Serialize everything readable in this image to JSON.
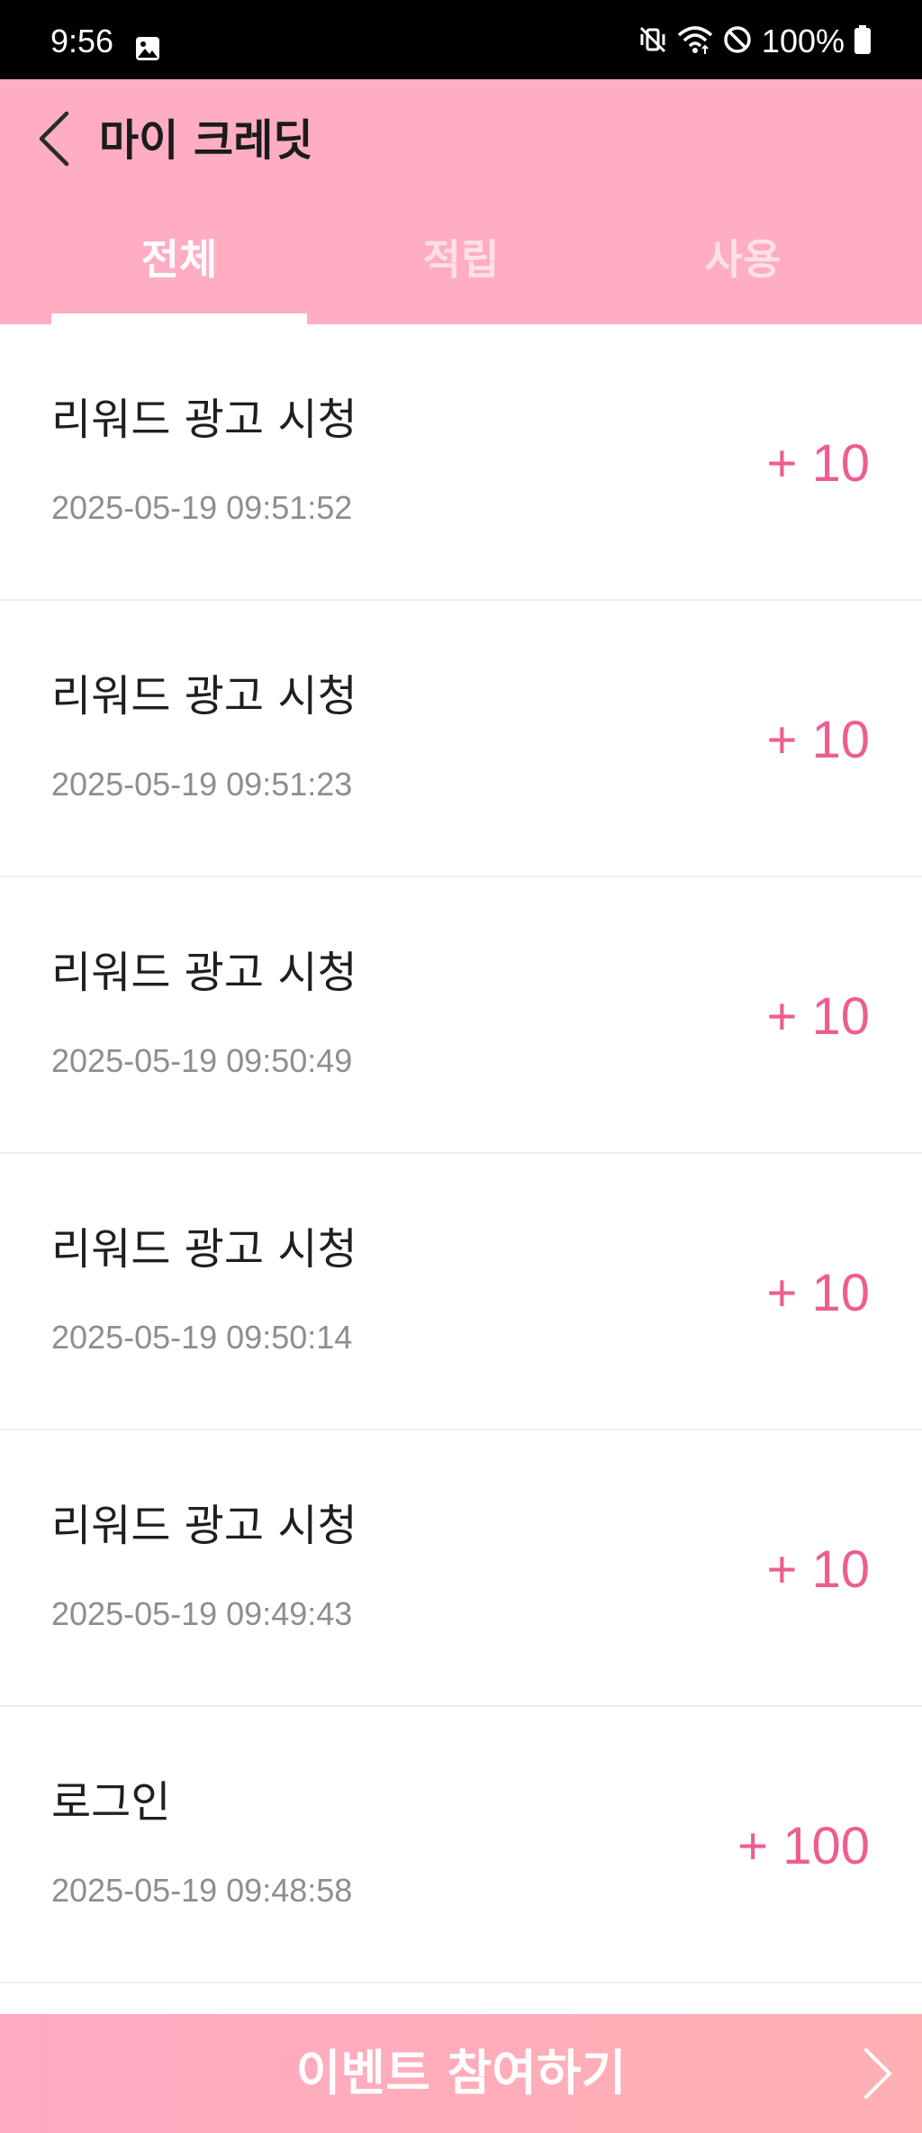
{
  "status_bar": {
    "time": "9:56",
    "battery": "100%",
    "icons": [
      "gallery-notification-icon",
      "vibrate-mute-icon",
      "wifi-icon",
      "do-not-disturb-icon",
      "battery-icon"
    ]
  },
  "header": {
    "title": "마이 크레딧",
    "back_icon": "chevron-left-icon",
    "background": "#ffadc2"
  },
  "tabs": [
    {
      "label": "전체",
      "selected": true
    },
    {
      "label": "적립",
      "selected": false
    },
    {
      "label": "사용",
      "selected": false
    }
  ],
  "transactions": [
    {
      "title": "리워드 광고 시청",
      "date": "2025-05-19 09:51:52",
      "amount": "+ 10"
    },
    {
      "title": "리워드 광고 시청",
      "date": "2025-05-19 09:51:23",
      "amount": "+ 10"
    },
    {
      "title": "리워드 광고 시청",
      "date": "2025-05-19 09:50:49",
      "amount": "+ 10"
    },
    {
      "title": "리워드 광고 시청",
      "date": "2025-05-19 09:50:14",
      "amount": "+ 10"
    },
    {
      "title": "리워드 광고 시청",
      "date": "2025-05-19 09:49:43",
      "amount": "+ 10"
    },
    {
      "title": "로그인",
      "date": "2025-05-19 09:48:58",
      "amount": "+ 100"
    }
  ],
  "event_bar": {
    "label": "이벤트 참여하기",
    "icon": "chevron-right-icon"
  },
  "colors": {
    "accent": "#ec5e91",
    "header": "#ffadc2",
    "date_text": "#8e8e8e"
  }
}
